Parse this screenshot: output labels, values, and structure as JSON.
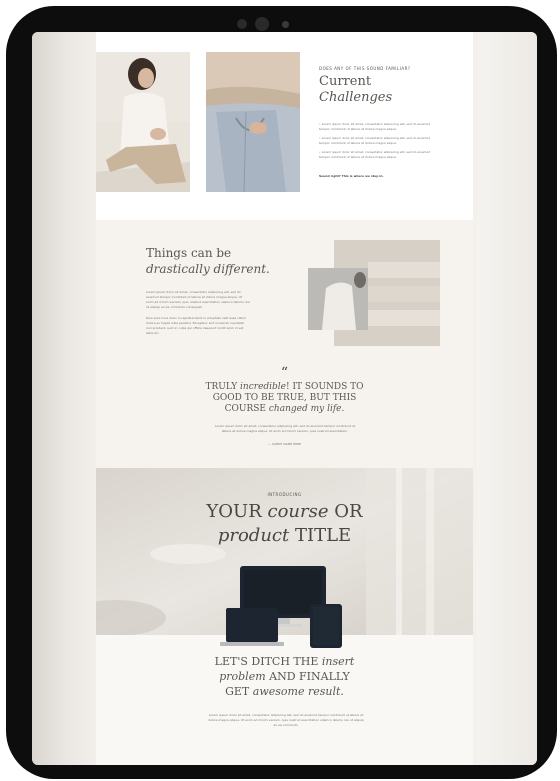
{
  "section_intro": {
    "eyebrow": "DOES ANY OF THIS SOUND FAMILIAR?",
    "title_line1": "Current",
    "title_line2": "Challenges",
    "bullets": [
      "• Lorem ipsum dolor sit amet, consectetur adipiscing elit, sed do eiusmod tempor incididunt ut labore et dolore magna aliqua.",
      "• Lorem ipsum dolor sit amet, consectetur adipiscing elit, sed do eiusmod tempor incididunt ut labore et dolore magna aliqua.",
      "• Lorem ipsum dolor sit amet, consectetur adipiscing elit, sed do eiusmod tempor incididunt ut labore et dolore magna aliqua."
    ],
    "cta_text": "Sound right? This is where we step in."
  },
  "section_different": {
    "title_line1": "Things can be",
    "title_line2": "drastically different.",
    "para1": "Lorem ipsum dolor sit amet, consectetur adipiscing elit, sed do eiusmod tempor incididunt ut labore et dolore magna aliqua. Ut enim ad minim veniam, quis nostrud exercitation ullamco laboris nisi ut aliquip ex ea commodo consequat.",
    "para2": "Duis aute irure dolor in reprehenderit in voluptate velit esse cillum dolore eu fugiat nulla pariatur. Excepteur sint occaecat cupidatat non proident, sunt in culpa qui officia deserunt mollit anim id est laborum."
  },
  "testimonial": {
    "quote_mark": "“",
    "line1_a": "TRULY ",
    "line1_b": "incredible",
    "line1_c": "! IT SOUNDS TO",
    "line2": "GOOD TO BE TRUE, BUT THIS",
    "line3_a": "COURSE ",
    "line3_b": "changed my life",
    "line3_c": ".",
    "body": "Lorem ipsum dolor sit amet, consectetur adipiscing elit, sed do eiusmod tempor incididunt ut labore et dolore magna aliqua. Ut enim ad minim veniam, quis nostrud exercitation.",
    "author": "— CLIENT NAME HERE"
  },
  "product": {
    "eyebrow": "INTRODUCING",
    "title_a": "YOUR ",
    "title_b": "course",
    "title_c": " OR",
    "title_d": "product",
    "title_e": " TITLE"
  },
  "result": {
    "line1_a": "LET'S DITCH THE ",
    "line1_b": "insert",
    "line2_a": "problem",
    "line2_b": " AND FINALLY",
    "line3_a": "GET ",
    "line3_b": "awesome result",
    "line3_c": ".",
    "body": "Lorem ipsum dolor sit amet, consectetur adipiscing elit, sed do eiusmod tempor incididunt ut labore et dolore magna aliqua. Ut enim ad minim veniam, quis nostrud exercitation ullamco laboris nisi ut aliquip ex ea commodo."
  }
}
